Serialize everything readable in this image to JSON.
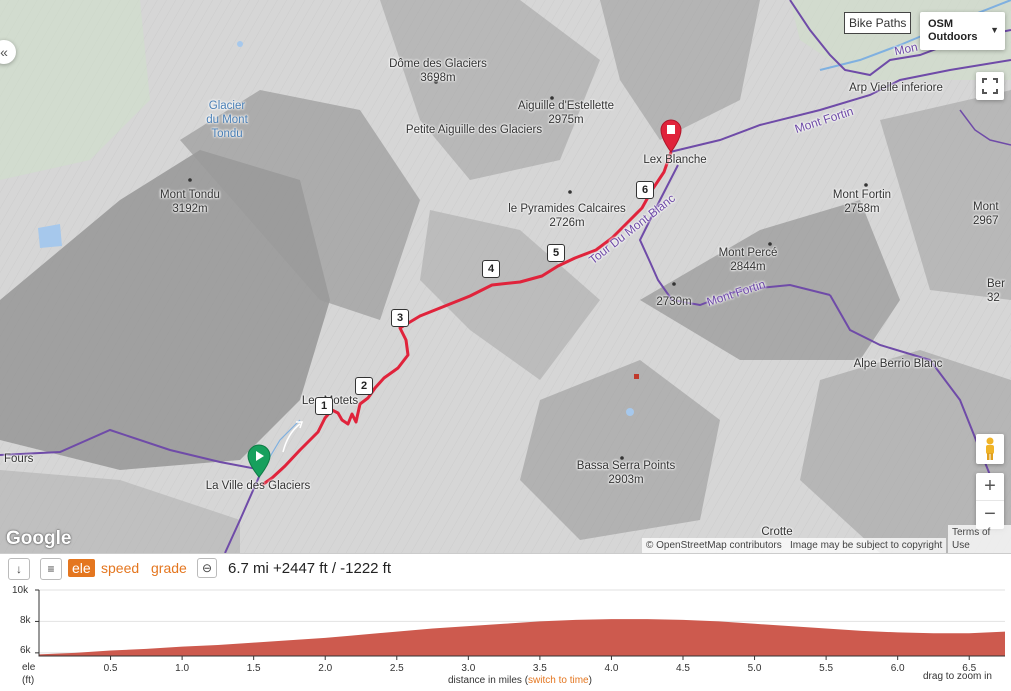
{
  "map": {
    "layer_button": "Bike Paths",
    "basemap_select": {
      "line1": "OSM",
      "line2": "Outdoors"
    },
    "zoom_in": "+",
    "zoom_out": "−",
    "google_logo": "Google",
    "collapse_left": "«",
    "attribution": {
      "osm": "© OpenStreetMap contributors",
      "copyright": "Image may be subject to copyright",
      "terms": "Terms of Use"
    },
    "labels": {
      "dome_name": "Dôme des Glaciers",
      "dome_elev": "3698m",
      "aig_estellette_name": "Aiguille d'Estellette",
      "aig_estellette_elev": "2975m",
      "petite_aig": "Petite Aiguille des Glaciers",
      "glacier_line1": "Glacier",
      "glacier_line2": "du Mont",
      "glacier_line3": "Tondu",
      "mont_tondu_name": "Mont Tondu",
      "mont_tondu_elev": "3192m",
      "pyramides_name": "le Pyramides Calcaires",
      "pyramides_elev": "2726m",
      "lex_blanche": "Lex Blanche",
      "arp_vielle": "Arp Vielle inferiore",
      "mont_fortin_name": "Mont Fortin",
      "mont_fortin_elev": "2758m",
      "mont_perce_name": "Mont Percé",
      "mont_perce_elev": "2844m",
      "elev_2730": "2730m",
      "alpe_berrio": "Alpe Berrio Blanc",
      "les_motets": "Les Motets",
      "ville_glaciers": "La Ville des Glaciers",
      "fours": "Fours",
      "bassa_serra_name": "Bassa Serra Points",
      "bassa_serra_elev": "2903m",
      "crotte": "Crotte",
      "mont_edge_name": "Mont",
      "mont_edge_elev": "2967",
      "ber_edge_name": "Ber",
      "ber_edge_elev": "32",
      "route_tmb": "Tour Du Mont Blanc",
      "route_mont_fortin_1": "Mont Fortin",
      "route_mont_fortin_2": "Mont Fortin",
      "route_mon": "Mon"
    },
    "waypoints": [
      "1",
      "2",
      "3",
      "4",
      "5",
      "6"
    ]
  },
  "profile": {
    "tabs": [
      "ele",
      "speed",
      "grade"
    ],
    "active_tab": "ele",
    "stats": "6.7 mi +2447 ft / -1222 ft",
    "y_ticks": [
      "10k",
      "8k",
      "6k"
    ],
    "y_label_1": "ele",
    "y_label_2": "(ft)",
    "x_ticks": [
      "0.5",
      "1.0",
      "1.5",
      "2.0",
      "2.5",
      "3.0",
      "3.5",
      "4.0",
      "4.5",
      "5.0",
      "5.5",
      "6.0",
      "6.5"
    ],
    "x_label": "distance in miles",
    "x_switch": "switch to time",
    "zoom_hint": "drag to zoom in",
    "colors": {
      "tab": "#e4761f",
      "fill": "#cd5a4e"
    }
  },
  "chart_data": {
    "type": "area",
    "xlabel": "distance in miles",
    "ylabel": "ele (ft)",
    "ylim": [
      5800,
      10000
    ],
    "xlim": [
      0,
      6.75
    ],
    "x": [
      0,
      0.25,
      0.5,
      0.75,
      1.0,
      1.25,
      1.5,
      1.75,
      2.0,
      2.25,
      2.5,
      2.75,
      3.0,
      3.25,
      3.5,
      3.75,
      4.0,
      4.25,
      4.5,
      4.75,
      5.0,
      5.25,
      5.5,
      5.75,
      6.0,
      6.25,
      6.5,
      6.75
    ],
    "y": [
      5900,
      6000,
      6150,
      6250,
      6400,
      6500,
      6650,
      6800,
      6950,
      7150,
      7350,
      7550,
      7700,
      7850,
      8000,
      8100,
      8150,
      8150,
      8100,
      8000,
      7850,
      7700,
      7550,
      7400,
      7300,
      7250,
      7250,
      7350
    ]
  }
}
